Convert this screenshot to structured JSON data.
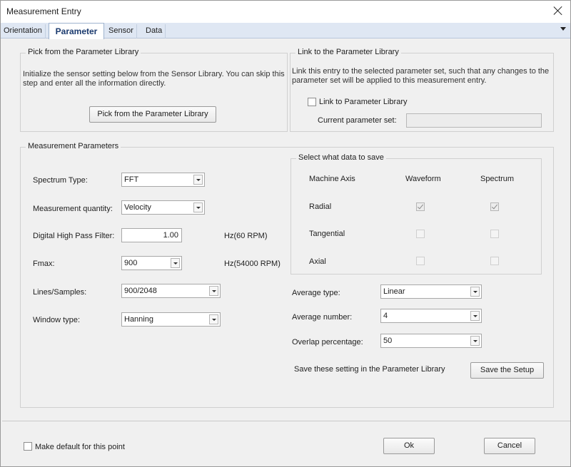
{
  "window": {
    "title": "Measurement Entry"
  },
  "tabs": [
    "Orientation",
    "Parameter",
    "Sensor",
    "Data"
  ],
  "pick_group": {
    "title": "Pick from the Parameter Library",
    "text_line1": "Initialize the sensor setting below from the Sensor Library. You can skip this",
    "text_line2": "step and enter all the information directly.",
    "button": "Pick from the Parameter Library"
  },
  "link_group": {
    "title": "Link to the Parameter Library",
    "text_line1": "Link this entry to the selected parameter set, such that any changes to the",
    "text_line2": "parameter set will be applied to this measurement entry.",
    "checkbox_label": "Link to Parameter Library",
    "current_label": "Current parameter set:",
    "current_value": ""
  },
  "measurement": {
    "title": "Measurement Parameters",
    "spectrum_type": {
      "label": "Spectrum Type:",
      "value": "FFT"
    },
    "quantity": {
      "label": "Measurement quantity:",
      "value": "Velocity"
    },
    "hpf": {
      "label": "Digital High Pass Filter:",
      "value": "1.00",
      "unit": "Hz(60 RPM)"
    },
    "fmax": {
      "label": "Fmax:",
      "value": "900",
      "unit": "Hz(54000 RPM)"
    },
    "lines": {
      "label": "Lines/Samples:",
      "value": "900/2048"
    },
    "window": {
      "label": "Window type:",
      "value": "Hanning"
    }
  },
  "save_group": {
    "title": "Select what data to save",
    "columns": [
      "Machine Axis",
      "Waveform",
      "Spectrum"
    ],
    "rows": [
      {
        "label": "Radial",
        "waveform": true,
        "spectrum": true
      },
      {
        "label": "Tangential",
        "waveform": false,
        "spectrum": false
      },
      {
        "label": "Axial",
        "waveform": false,
        "spectrum": false
      }
    ]
  },
  "averaging": {
    "type": {
      "label": "Average type:",
      "value": "Linear"
    },
    "number": {
      "label": "Average number:",
      "value": "4"
    },
    "overlap": {
      "label": "Overlap percentage:",
      "value": "50"
    }
  },
  "setup": {
    "label": "Save these setting in the Parameter Library",
    "button": "Save the Setup"
  },
  "footer": {
    "default_label": "Make default for this point",
    "ok": "Ok",
    "cancel": "Cancel"
  }
}
